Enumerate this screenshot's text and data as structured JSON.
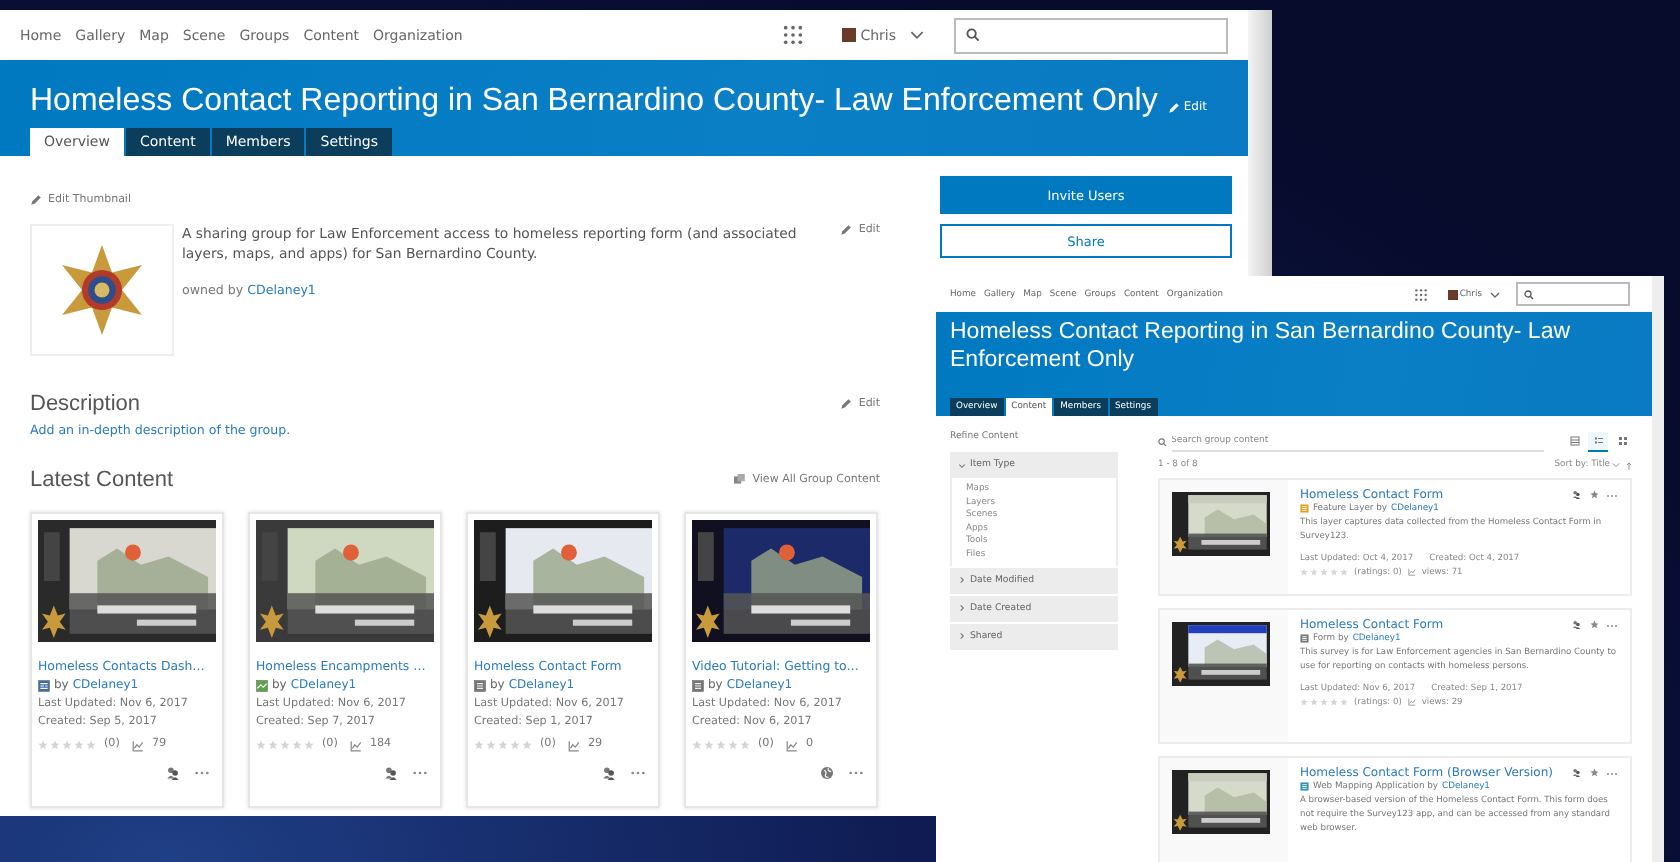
{
  "main": {
    "nav": [
      "Home",
      "Gallery",
      "Map",
      "Scene",
      "Groups",
      "Content",
      "Organization"
    ],
    "user": "Chris",
    "title": "Homeless Contact Reporting in San Bernardino County- Law Enforcement Only",
    "title_edit": "Edit",
    "tabs": [
      {
        "label": "Overview",
        "selected": true
      },
      {
        "label": "Content",
        "selected": false
      },
      {
        "label": "Members",
        "selected": false
      },
      {
        "label": "Settings",
        "selected": false
      }
    ],
    "edit_thumbnail": "Edit Thumbnail",
    "summary": "A sharing group for Law Enforcement access to homeless reporting form (and associated layers, maps, and apps) for San Bernardino County.",
    "summary_edit": "Edit",
    "owned_by": "owned by",
    "owner": "CDelaney1",
    "description_heading": "Description",
    "description_edit": "Edit",
    "description_link": "Add an in-depth description of the group.",
    "latest_heading": "Latest Content",
    "view_all": "View All Group Content",
    "cards": [
      {
        "title": "Homeless Contacts Dash…",
        "kind": "dashboard",
        "by": "by",
        "owner": "CDelaney1",
        "updated": "Last Updated: Nov 6, 2017",
        "created": "Created: Sep 5, 2017",
        "stars": 0,
        "ratings": "(0)",
        "views": "79",
        "public": false
      },
      {
        "title": "Homeless Encampments …",
        "kind": "map",
        "by": "by",
        "owner": "CDelaney1",
        "updated": "Last Updated: Nov 6, 2017",
        "created": "Created: Sep 7, 2017",
        "stars": 0,
        "ratings": "(0)",
        "views": "184",
        "public": false
      },
      {
        "title": "Homeless Contact Form",
        "kind": "form",
        "by": "by",
        "owner": "CDelaney1",
        "updated": "Last Updated: Nov 6, 2017",
        "created": "Created: Sep 1, 2017",
        "stars": 0,
        "ratings": "(0)",
        "views": "29",
        "public": false
      },
      {
        "title": "Video Tutorial: Getting to…",
        "kind": "form",
        "by": "by",
        "owner": "CDelaney1",
        "updated": "Last Updated: Nov 6, 2017",
        "created": "Created: Nov 6, 2017",
        "stars": 0,
        "ratings": "(0)",
        "views": "0",
        "public": true
      }
    ],
    "invite": "Invite Users",
    "share": "Share"
  },
  "second": {
    "nav": [
      "Home",
      "Gallery",
      "Map",
      "Scene",
      "Groups",
      "Content",
      "Organization"
    ],
    "user": "Chris",
    "title": "Homeless Contact Reporting in San Bernardino County- Law Enforcement Only",
    "tabs": [
      {
        "label": "Overview",
        "selected": false
      },
      {
        "label": "Content",
        "selected": true
      },
      {
        "label": "Members",
        "selected": false
      },
      {
        "label": "Settings",
        "selected": false
      }
    ],
    "refine": "Refine Content",
    "filters": [
      {
        "label": "Item Type",
        "expanded": true,
        "options": [
          "Maps",
          "Layers",
          "Scenes",
          "Apps",
          "Tools",
          "Files"
        ]
      },
      {
        "label": "Date Modified",
        "expanded": false
      },
      {
        "label": "Date Created",
        "expanded": false
      },
      {
        "label": "Shared",
        "expanded": false
      }
    ],
    "search_placeholder": "Search group content",
    "views": [
      {
        "kind": "table",
        "selected": false
      },
      {
        "kind": "list",
        "selected": true
      },
      {
        "kind": "grid",
        "selected": false
      }
    ],
    "count": "1 - 8 of 8",
    "sort": "Sort by: Title",
    "items": [
      {
        "title": "Homeless Contact Form",
        "kind": "layer",
        "type_label": "Feature Layer by",
        "owner": "CDelaney1",
        "description": "This layer captures data collected from the Homeless Contact Form in Survey123.",
        "updated": "Last Updated: Oct 4, 2017",
        "created": "Created: Oct 4, 2017",
        "stars": 0,
        "ratings": "(ratings: 0)",
        "views": "views: 71"
      },
      {
        "title": "Homeless Contact Form",
        "kind": "form",
        "type_label": "Form by",
        "owner": "CDelaney1",
        "description": "This survey is for Law Enforcement agencies in San Bernardino County to use for reporting on contacts with homeless persons.",
        "updated": "Last Updated: Nov 6, 2017",
        "created": "Created: Sep 1, 2017",
        "stars": 0,
        "ratings": "(ratings: 0)",
        "views": "views: 29"
      },
      {
        "title": "Homeless Contact Form (Browser Version)",
        "kind": "app",
        "type_label": "Web Mapping Application by",
        "owner": "CDelaney1",
        "description": "A browser-based version of the Homeless Contact Form. This form does not require the Survey123 app, and can be accessed from any standard web browser."
      }
    ]
  }
}
